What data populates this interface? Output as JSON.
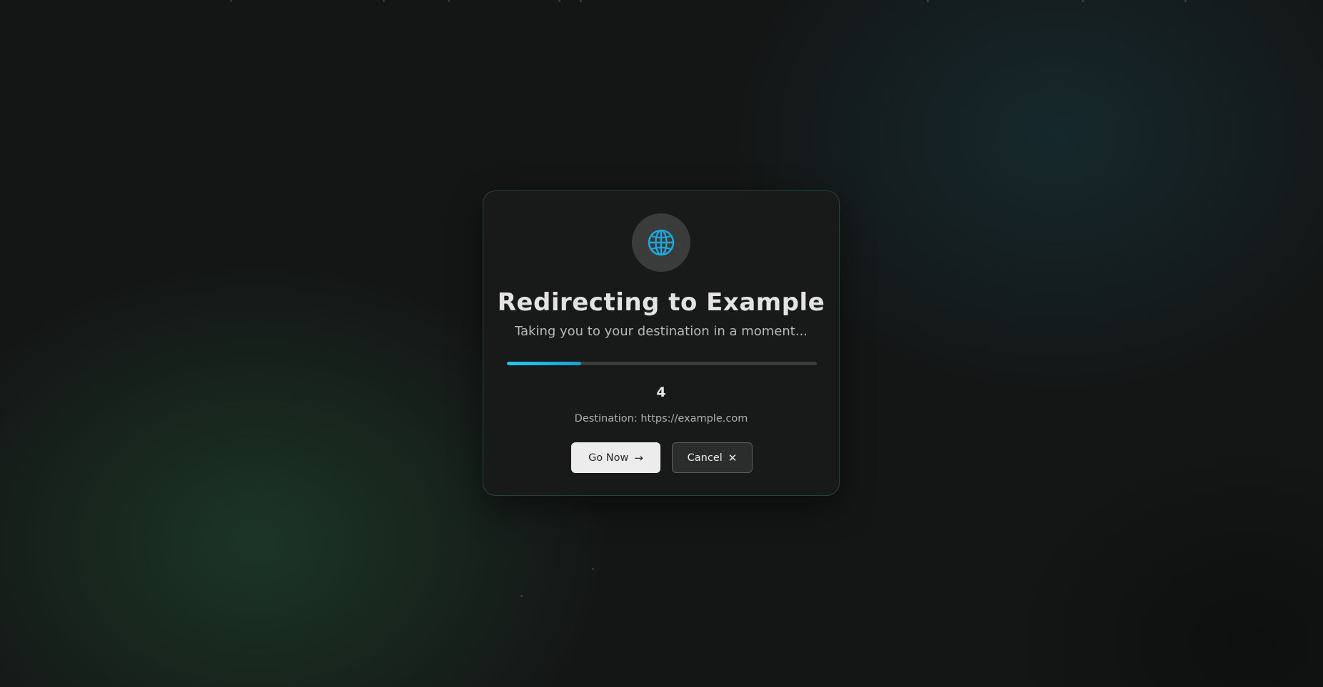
{
  "background": {
    "colors": {
      "base": "#141616",
      "green_glow": "#204a30",
      "teal_glow": "#16343a"
    }
  },
  "redirect_card": {
    "icon": "globe-icon",
    "title": "Redirecting to Example",
    "subtitle": "Taking you to your destination in a moment...",
    "progress_fraction": 0.24,
    "countdown": "4",
    "destination_text": "Destination: https://example.com",
    "buttons": {
      "go_now": {
        "label": "Go Now",
        "icon": "arrow-right-icon",
        "icon_glyph": "→"
      },
      "cancel": {
        "label": "Cancel",
        "icon": "close-icon",
        "icon_glyph": "✕"
      }
    },
    "colors": {
      "accent": "#22c9ea",
      "card_border": "#24473a",
      "card_background": "#181919"
    }
  }
}
